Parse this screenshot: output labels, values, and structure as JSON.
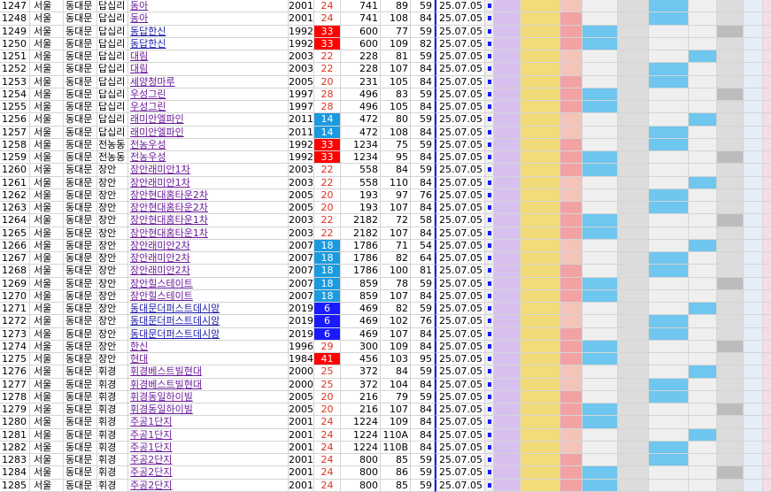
{
  "rows": [
    {
      "id": "1247",
      "city": "서울",
      "gu": "동대문",
      "dong": "답십리",
      "apt": "동아",
      "year": "2001",
      "age": "24",
      "hh": "741",
      "area": "89",
      "size": "59",
      "date": "25.07.05",
      "age_style": "normal",
      "apt_color": "#6a1b9a"
    },
    {
      "id": "1248",
      "city": "서울",
      "gu": "동대문",
      "dong": "답십리",
      "apt": "동아",
      "year": "2001",
      "age": "24",
      "hh": "741",
      "area": "108",
      "size": "84",
      "date": "25.07.05",
      "age_style": "normal",
      "apt_color": "#6a1b9a"
    },
    {
      "id": "1249",
      "city": "서울",
      "gu": "동대문",
      "dong": "답십리",
      "apt": "동답한신",
      "year": "1992",
      "age": "33",
      "hh": "600",
      "area": "77",
      "size": "59",
      "date": "25.07.05",
      "age_style": "red",
      "apt_color": "#1a1aaa"
    },
    {
      "id": "1250",
      "city": "서울",
      "gu": "동대문",
      "dong": "답십리",
      "apt": "동답한신",
      "year": "1992",
      "age": "33",
      "hh": "600",
      "area": "109",
      "size": "82",
      "date": "25.07.05",
      "age_style": "red",
      "apt_color": "#1a1aaa"
    },
    {
      "id": "1251",
      "city": "서울",
      "gu": "동대문",
      "dong": "답십리",
      "apt": "대림",
      "year": "2003",
      "age": "22",
      "hh": "228",
      "area": "81",
      "size": "59",
      "date": "25.07.05",
      "age_style": "normal",
      "apt_color": "#6a1b9a"
    },
    {
      "id": "1252",
      "city": "서울",
      "gu": "동대문",
      "dong": "답십리",
      "apt": "대림",
      "year": "2003",
      "age": "22",
      "hh": "228",
      "area": "107",
      "size": "84",
      "date": "25.07.05",
      "age_style": "normal",
      "apt_color": "#6a1b9a"
    },
    {
      "id": "1253",
      "city": "서울",
      "gu": "동대문",
      "dong": "답십리",
      "apt": "세양청마루",
      "year": "2005",
      "age": "20",
      "hh": "231",
      "area": "105",
      "size": "84",
      "date": "25.07.05",
      "age_style": "normal",
      "apt_color": "#6a1b9a"
    },
    {
      "id": "1254",
      "city": "서울",
      "gu": "동대문",
      "dong": "답십리",
      "apt": "우성그린",
      "year": "1997",
      "age": "28",
      "hh": "496",
      "area": "83",
      "size": "59",
      "date": "25.07.05",
      "age_style": "normal",
      "apt_color": "#6a1b9a"
    },
    {
      "id": "1255",
      "city": "서울",
      "gu": "동대문",
      "dong": "답십리",
      "apt": "우성그린",
      "year": "1997",
      "age": "28",
      "hh": "496",
      "area": "105",
      "size": "84",
      "date": "25.07.05",
      "age_style": "normal",
      "apt_color": "#6a1b9a"
    },
    {
      "id": "1256",
      "city": "서울",
      "gu": "동대문",
      "dong": "답십리",
      "apt": "래미안엘파인",
      "year": "2011",
      "age": "14",
      "hh": "472",
      "area": "80",
      "size": "59",
      "date": "25.07.05",
      "age_style": "blue",
      "apt_color": "#6a1b9a"
    },
    {
      "id": "1257",
      "city": "서울",
      "gu": "동대문",
      "dong": "답십리",
      "apt": "래미안엘파인",
      "year": "2011",
      "age": "14",
      "hh": "472",
      "area": "108",
      "size": "84",
      "date": "25.07.05",
      "age_style": "blue",
      "apt_color": "#6a1b9a"
    },
    {
      "id": "1258",
      "city": "서울",
      "gu": "동대문",
      "dong": "전농동",
      "apt": "전농우성",
      "year": "1992",
      "age": "33",
      "hh": "1234",
      "area": "75",
      "size": "59",
      "date": "25.07.05",
      "age_style": "red",
      "apt_color": "#6a1b9a"
    },
    {
      "id": "1259",
      "city": "서울",
      "gu": "동대문",
      "dong": "전농동",
      "apt": "전농우성",
      "year": "1992",
      "age": "33",
      "hh": "1234",
      "area": "95",
      "size": "84",
      "date": "25.07.05",
      "age_style": "red",
      "apt_color": "#6a1b9a"
    },
    {
      "id": "1260",
      "city": "서울",
      "gu": "동대문",
      "dong": "장안",
      "apt": "장안래미안1차",
      "year": "2003",
      "age": "22",
      "hh": "558",
      "area": "84",
      "size": "59",
      "date": "25.07.05",
      "age_style": "normal",
      "apt_color": "#6a1b9a"
    },
    {
      "id": "1261",
      "city": "서울",
      "gu": "동대문",
      "dong": "장안",
      "apt": "장안래미안1차",
      "year": "2003",
      "age": "22",
      "hh": "558",
      "area": "110",
      "size": "84",
      "date": "25.07.05",
      "age_style": "normal",
      "apt_color": "#6a1b9a"
    },
    {
      "id": "1262",
      "city": "서울",
      "gu": "동대문",
      "dong": "장안",
      "apt": "장안현대홈타운2차",
      "year": "2005",
      "age": "20",
      "hh": "193",
      "area": "97",
      "size": "76",
      "date": "25.07.05",
      "age_style": "normal",
      "apt_color": "#6a1b9a"
    },
    {
      "id": "1263",
      "city": "서울",
      "gu": "동대문",
      "dong": "장안",
      "apt": "장안현대홈타운2차",
      "year": "2005",
      "age": "20",
      "hh": "193",
      "area": "107",
      "size": "84",
      "date": "25.07.05",
      "age_style": "normal",
      "apt_color": "#6a1b9a"
    },
    {
      "id": "1264",
      "city": "서울",
      "gu": "동대문",
      "dong": "장안",
      "apt": "장안현대홈타운1차",
      "year": "2003",
      "age": "22",
      "hh": "2182",
      "area": "72",
      "size": "58",
      "date": "25.07.05",
      "age_style": "normal",
      "apt_color": "#6a1b9a"
    },
    {
      "id": "1265",
      "city": "서울",
      "gu": "동대문",
      "dong": "장안",
      "apt": "장안현대홈타운1차",
      "year": "2003",
      "age": "22",
      "hh": "2182",
      "area": "107",
      "size": "84",
      "date": "25.07.05",
      "age_style": "normal",
      "apt_color": "#6a1b9a"
    },
    {
      "id": "1266",
      "city": "서울",
      "gu": "동대문",
      "dong": "장안",
      "apt": "장안래미안2차",
      "year": "2007",
      "age": "18",
      "hh": "1786",
      "area": "71",
      "size": "54",
      "date": "25.07.05",
      "age_style": "blue",
      "apt_color": "#6a1b9a"
    },
    {
      "id": "1267",
      "city": "서울",
      "gu": "동대문",
      "dong": "장안",
      "apt": "장안래미안2차",
      "year": "2007",
      "age": "18",
      "hh": "1786",
      "area": "82",
      "size": "64",
      "date": "25.07.05",
      "age_style": "blue",
      "apt_color": "#6a1b9a"
    },
    {
      "id": "1268",
      "city": "서울",
      "gu": "동대문",
      "dong": "장안",
      "apt": "장안래미안2차",
      "year": "2007",
      "age": "18",
      "hh": "1786",
      "area": "100",
      "size": "81",
      "date": "25.07.05",
      "age_style": "blue",
      "apt_color": "#6a1b9a"
    },
    {
      "id": "1269",
      "city": "서울",
      "gu": "동대문",
      "dong": "장안",
      "apt": "장안힐스테이트",
      "year": "2007",
      "age": "18",
      "hh": "859",
      "area": "78",
      "size": "59",
      "date": "25.07.05",
      "age_style": "blue",
      "apt_color": "#6a1b9a"
    },
    {
      "id": "1270",
      "city": "서울",
      "gu": "동대문",
      "dong": "장안",
      "apt": "장안힐스테이트",
      "year": "2007",
      "age": "18",
      "hh": "859",
      "area": "107",
      "size": "84",
      "date": "25.07.05",
      "age_style": "blue",
      "apt_color": "#6a1b9a"
    },
    {
      "id": "1271",
      "city": "서울",
      "gu": "동대문",
      "dong": "장안",
      "apt": "동대문더퍼스트데시앙",
      "year": "2019",
      "age": "6",
      "hh": "469",
      "area": "82",
      "size": "59",
      "date": "25.07.05",
      "age_style": "navy",
      "apt_color": "#1a1aaa"
    },
    {
      "id": "1272",
      "city": "서울",
      "gu": "동대문",
      "dong": "장안",
      "apt": "동대문더퍼스트데시앙",
      "year": "2019",
      "age": "6",
      "hh": "469",
      "area": "102",
      "size": "76",
      "date": "25.07.05",
      "age_style": "navy",
      "apt_color": "#1a1aaa"
    },
    {
      "id": "1273",
      "city": "서울",
      "gu": "동대문",
      "dong": "장안",
      "apt": "동대문더퍼스트데시앙",
      "year": "2019",
      "age": "6",
      "hh": "469",
      "area": "107",
      "size": "84",
      "date": "25.07.05",
      "age_style": "navy",
      "apt_color": "#1a1aaa"
    },
    {
      "id": "1274",
      "city": "서울",
      "gu": "동대문",
      "dong": "장안",
      "apt": "한신",
      "year": "1996",
      "age": "29",
      "hh": "300",
      "area": "109",
      "size": "84",
      "date": "25.07.05",
      "age_style": "normal",
      "apt_color": "#6a1b9a"
    },
    {
      "id": "1275",
      "city": "서울",
      "gu": "동대문",
      "dong": "장안",
      "apt": "현대",
      "year": "1984",
      "age": "41",
      "hh": "456",
      "area": "103",
      "size": "95",
      "date": "25.07.05",
      "age_style": "red",
      "apt_color": "#6a1b9a"
    },
    {
      "id": "1276",
      "city": "서울",
      "gu": "동대문",
      "dong": "휘경",
      "apt": "휘경베스트빌현대",
      "year": "2000",
      "age": "25",
      "hh": "372",
      "area": "84",
      "size": "59",
      "date": "25.07.05",
      "age_style": "normal",
      "apt_color": "#6a1b9a"
    },
    {
      "id": "1277",
      "city": "서울",
      "gu": "동대문",
      "dong": "휘경",
      "apt": "휘경베스트빌현대",
      "year": "2000",
      "age": "25",
      "hh": "372",
      "area": "104",
      "size": "84",
      "date": "25.07.05",
      "age_style": "normal",
      "apt_color": "#6a1b9a"
    },
    {
      "id": "1278",
      "city": "서울",
      "gu": "동대문",
      "dong": "휘경",
      "apt": "휘경동일하이빌",
      "year": "2005",
      "age": "20",
      "hh": "216",
      "area": "79",
      "size": "59",
      "date": "25.07.05",
      "age_style": "normal",
      "apt_color": "#6a1b9a"
    },
    {
      "id": "1279",
      "city": "서울",
      "gu": "동대문",
      "dong": "휘경",
      "apt": "휘경동일하이빌",
      "year": "2005",
      "age": "20",
      "hh": "216",
      "area": "107",
      "size": "84",
      "date": "25.07.05",
      "age_style": "normal",
      "apt_color": "#6a1b9a"
    },
    {
      "id": "1280",
      "city": "서울",
      "gu": "동대문",
      "dong": "휘경",
      "apt": "주공1단지",
      "year": "2001",
      "age": "24",
      "hh": "1224",
      "area": "109",
      "size": "84",
      "date": "25.07.05",
      "age_style": "normal",
      "apt_color": "#6a1b9a"
    },
    {
      "id": "1281",
      "city": "서울",
      "gu": "동대문",
      "dong": "휘경",
      "apt": "주공1단지",
      "year": "2001",
      "age": "24",
      "hh": "1224",
      "area": "110A",
      "size": "84",
      "date": "25.07.05",
      "age_style": "normal",
      "apt_color": "#6a1b9a"
    },
    {
      "id": "1282",
      "city": "서울",
      "gu": "동대문",
      "dong": "휘경",
      "apt": "주공1단지",
      "year": "2001",
      "age": "24",
      "hh": "1224",
      "area": "110B",
      "size": "84",
      "date": "25.07.05",
      "age_style": "normal",
      "apt_color": "#6a1b9a"
    },
    {
      "id": "1283",
      "city": "서울",
      "gu": "동대문",
      "dong": "휘경",
      "apt": "주공2단지",
      "year": "2001",
      "age": "24",
      "hh": "800",
      "area": "85",
      "size": "59",
      "date": "25.07.05",
      "age_style": "normal",
      "apt_color": "#6a1b9a"
    },
    {
      "id": "1284",
      "city": "서울",
      "gu": "동대문",
      "dong": "휘경",
      "apt": "주공2단지",
      "year": "2001",
      "age": "24",
      "hh": "800",
      "area": "86",
      "size": "59",
      "date": "25.07.05",
      "age_style": "normal",
      "apt_color": "#6a1b9a"
    },
    {
      "id": "1285",
      "city": "서울",
      "gu": "동대문",
      "dong": "휘경",
      "apt": "주공2단지",
      "year": "2001",
      "age": "24",
      "hh": "800",
      "area": "85",
      "size": "59",
      "date": "25.07.05",
      "age_style": "normal",
      "apt_color": "#6a1b9a"
    }
  ],
  "age_styles": {
    "normal": {
      "bg": "#ffffff",
      "fg": "#e0301e"
    },
    "red": {
      "bg": "#ff0000",
      "fg": "#ffffff"
    },
    "blue": {
      "bg": "#1a9be0",
      "fg": "#ffffff"
    },
    "navy": {
      "bg": "#1a1aff",
      "fg": "#ffffff"
    }
  },
  "colors": {
    "grid": "#d4d4d4",
    "date_border": "#1a1aff",
    "blur_palette": [
      "#f0c8d6",
      "#d8c0ee",
      "#f2dc7a",
      "#f3c4b8",
      "#f2a2a2",
      "#dcdcdc",
      "#bcbcbc",
      "#6fc6ee",
      "#efefef",
      "#e4eef8",
      "#f6dce6"
    ]
  }
}
